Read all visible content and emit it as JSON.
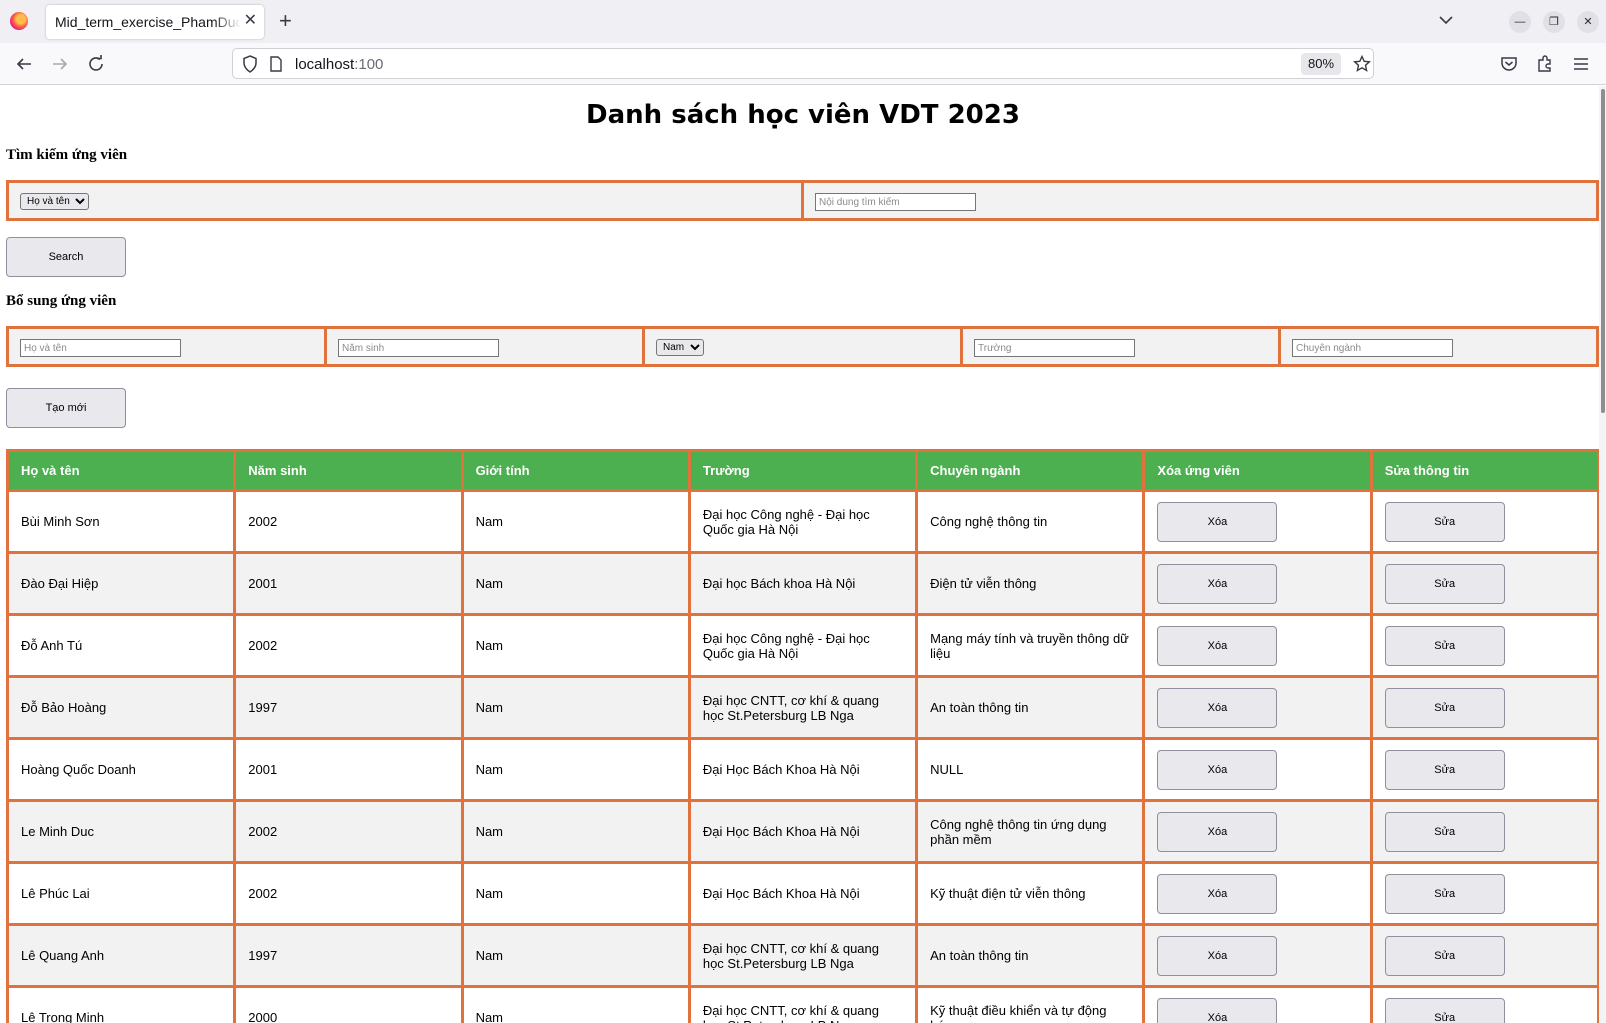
{
  "browser": {
    "tab_title": "Mid_term_exercise_PhamDuc",
    "url_host": "localhost",
    "url_port": ":100",
    "zoom": "80%"
  },
  "page": {
    "title": "Danh sách học viên VDT 2023"
  },
  "search": {
    "heading": "Tìm kiếm ứng viên",
    "field_selected": "Họ và tên",
    "query_placeholder": "Nội dung tìm kiếm",
    "button_label": "Search"
  },
  "add": {
    "heading": "Bổ sung ứng viên",
    "name_placeholder": "Họ và tên",
    "year_placeholder": "Năm sinh",
    "gender_selected": "Nam",
    "school_placeholder": "Trường",
    "major_placeholder": "Chuyên ngành",
    "button_label": "Tạo mới"
  },
  "table": {
    "headers": [
      "Họ và tên",
      "Năm sinh",
      "Giới tính",
      "Trường",
      "Chuyên ngành",
      "Xóa ứng viên",
      "Sửa thông tin"
    ],
    "delete_label": "Xóa",
    "edit_label": "Sửa",
    "rows": [
      {
        "name": "Bùi Minh Sơn",
        "year": "2002",
        "gender": "Nam",
        "school": "Đại học Công nghệ - Đại học Quốc gia Hà Nội",
        "major": "Công nghệ thông tin"
      },
      {
        "name": "Đào Đại Hiệp",
        "year": "2001",
        "gender": "Nam",
        "school": "Đại học Bách khoa Hà Nội",
        "major": "Điện tử viễn thông"
      },
      {
        "name": "Đỗ Anh Tú",
        "year": "2002",
        "gender": "Nam",
        "school": "Đại học Công nghệ - Đại học Quốc gia Hà Nội",
        "major": "Mạng máy tính và truyền thông dữ liệu"
      },
      {
        "name": "Đỗ Bảo Hoàng",
        "year": "1997",
        "gender": "Nam",
        "school": "Đại học CNTT, cơ khí & quang học St.Petersburg LB Nga",
        "major": "An toàn thông tin"
      },
      {
        "name": "Hoàng Quốc Doanh",
        "year": "2001",
        "gender": "Nam",
        "school": "Đại Học Bách Khoa Hà Nội",
        "major": "NULL"
      },
      {
        "name": "Le Minh Duc",
        "year": "2002",
        "gender": "Nam",
        "school": "Đại Học Bách Khoa Hà Nội",
        "major": "Công nghệ thông tin ứng dụng phần mềm"
      },
      {
        "name": "Lê Phúc Lai",
        "year": "2002",
        "gender": "Nam",
        "school": "Đại Học Bách Khoa Hà Nội",
        "major": "Kỹ thuật điện tử viễn thông"
      },
      {
        "name": "Lê Quang Anh",
        "year": "1997",
        "gender": "Nam",
        "school": "Đại học CNTT, cơ khí & quang học St.Petersburg LB Nga",
        "major": "An toàn thông tin"
      },
      {
        "name": "Lê Trọng Minh",
        "year": "2000",
        "gender": "Nam",
        "school": "Đại học CNTT, cơ khí & quang học St.Petersburg LB Nga",
        "major": "Kỹ thuật điều khiển và tự động hóa"
      }
    ]
  },
  "icons": {
    "back": "arrow-left-icon",
    "forward": "arrow-right-icon",
    "reload": "reload-icon",
    "bookmark": "star-icon",
    "pocket": "pocket-icon",
    "extensions": "puzzle-icon",
    "menu": "hamburger-menu-icon"
  },
  "colors": {
    "border_accent": "#e0733d",
    "header_green": "#4caf50"
  }
}
